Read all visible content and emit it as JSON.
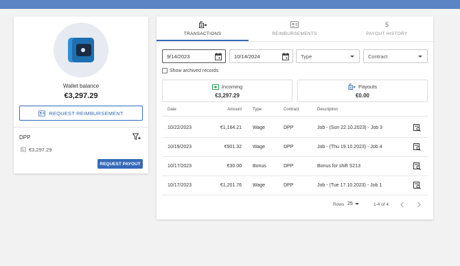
{
  "wallet": {
    "balance_label": "Wallet balance",
    "balance_value": "€3,297.29",
    "request_reimbursement_label": "REQUEST REIMBURSEMENT",
    "contract_name": "DPP",
    "contract_amount": "€3,297.29",
    "request_payout_label": "REQUEST PAYOUT"
  },
  "tabs": [
    {
      "label": "TRANSACTIONS",
      "icon": "transactions-icon",
      "active": true
    },
    {
      "label": "REIMBURSEMENTS",
      "icon": "reimbursements-icon",
      "active": false
    },
    {
      "label": "PAYOUT HISTORY",
      "icon": "dollar-icon",
      "active": false
    }
  ],
  "filters": {
    "date_from": "9/14/2023",
    "date_to": "10/14/2024",
    "type_placeholder": "Type",
    "contract_placeholder": "Contract",
    "show_archived_label": "Show archived records"
  },
  "summary": {
    "incoming_label": "Incoming",
    "incoming_value": "€3,297.29",
    "payouts_label": "Payouts",
    "payouts_value": "€0.00"
  },
  "table": {
    "headers": [
      "Date",
      "Amount",
      "Type",
      "Contract",
      "Description"
    ],
    "rows": [
      {
        "date": "10/22/2023",
        "amount": "€1,164.21",
        "type": "Wage",
        "contract": "DPP",
        "description": "Job - (Sun 22.10.2023) - Job 3"
      },
      {
        "date": "10/19/2023",
        "amount": "€901.32",
        "type": "Wage",
        "contract": "DPP",
        "description": "Job - (Thu 19.10.2023) - Job 4"
      },
      {
        "date": "10/17/2023",
        "amount": "€30.00",
        "type": "Bonus",
        "contract": "DPP",
        "description": "Bonus for shift S213"
      },
      {
        "date": "10/17/2023",
        "amount": "€1,201.76",
        "type": "Wage",
        "contract": "DPP",
        "description": "Job - (Tue 17.10.2023) - Job 1"
      }
    ]
  },
  "pagination": {
    "rows_label": "Rows",
    "rows_per_page": "25",
    "range_text": "1-4 of 4"
  },
  "colors": {
    "accent": "#3569b8",
    "topbar": "#5b84c4",
    "incoming_icon": "#2e9e4f"
  }
}
